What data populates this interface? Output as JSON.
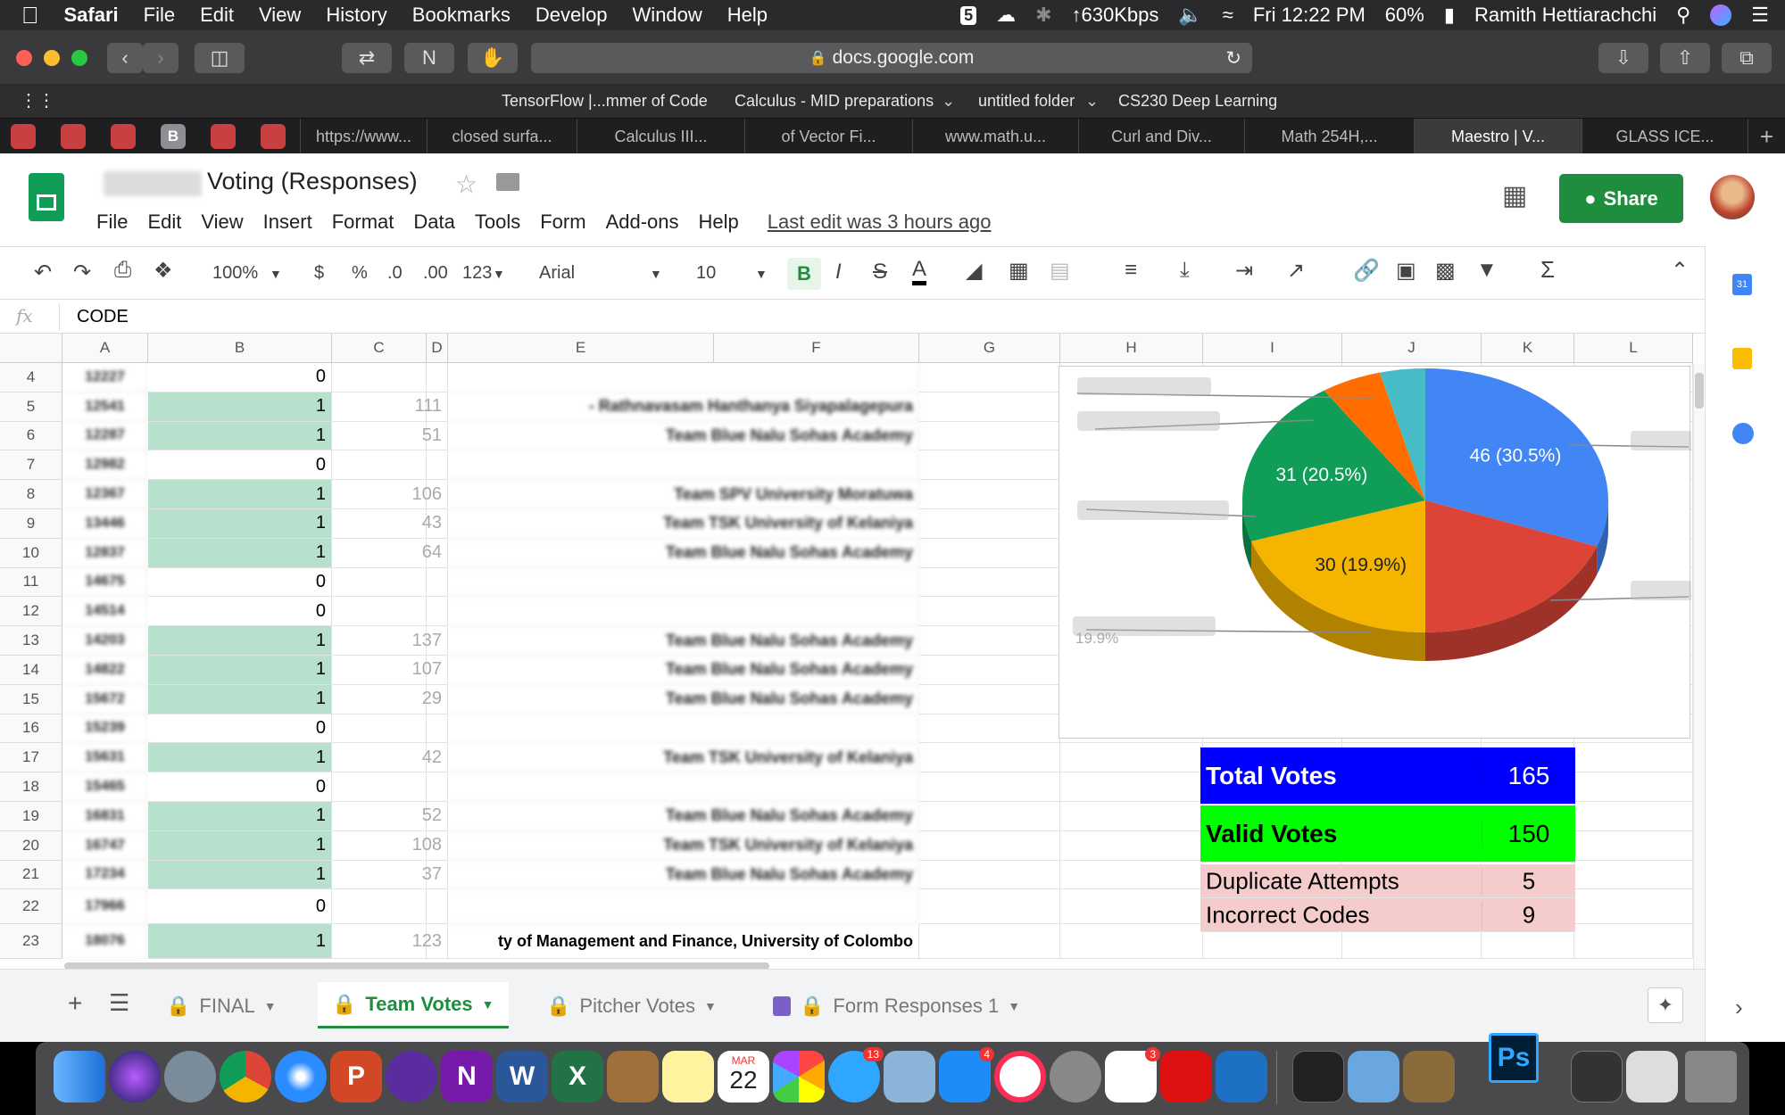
{
  "menubar": {
    "app": "Safari",
    "items": [
      "File",
      "Edit",
      "View",
      "History",
      "Bookmarks",
      "Develop",
      "Window",
      "Help"
    ],
    "network": "↑630Kbps",
    "clock": "Fri 12:22 PM",
    "battery": "60%",
    "user": "Ramith Hettiarachchi"
  },
  "browser": {
    "url": "docs.google.com",
    "favorites": [
      "TensorFlow |...mmer of Code",
      "Calculus - MID preparations",
      "untitled folder",
      "CS230 Deep Learning"
    ],
    "pinned_badge": "B",
    "tabs": [
      "https://www...",
      "closed surfa...",
      "Calculus III...",
      "of Vector Fi...",
      "www.math.u...",
      "Curl and Div...",
      "Math 254H,...",
      "Maestro | V...",
      "GLASS ICE..."
    ],
    "active_tab_index": 7,
    "new_tab": "+"
  },
  "doc": {
    "title": "Voting (Responses)",
    "menus": [
      "File",
      "Edit",
      "View",
      "Insert",
      "Format",
      "Data",
      "Tools",
      "Form",
      "Add-ons",
      "Help"
    ],
    "last_edit": "Last edit was 3 hours ago",
    "share_label": "Share"
  },
  "toolbar": {
    "zoom": "100%",
    "currency": "$",
    "percent": "%",
    "dec_less": ".0",
    "dec_more": ".00",
    "format_more": "123",
    "font": "Arial",
    "font_size": "10",
    "bold": "B",
    "italic": "I",
    "strike": "S",
    "text_color": "A"
  },
  "formula_bar": {
    "fx": "fx",
    "value": "CODE"
  },
  "columns": [
    "A",
    "B",
    "C",
    "D",
    "E",
    "F",
    "G",
    "H",
    "I",
    "J",
    "K",
    "L"
  ],
  "rows": [
    {
      "n": "4",
      "a": "12227",
      "b": "0",
      "d": "",
      "f": ""
    },
    {
      "n": "5",
      "a": "12541",
      "b": "1",
      "d": "111",
      "f": "- Rathnavasam Hanthanya Siyapalagepura"
    },
    {
      "n": "6",
      "a": "12287",
      "b": "1",
      "d": "51",
      "f": "Team Blue Nalu Sohas Academy"
    },
    {
      "n": "7",
      "a": "12982",
      "b": "0",
      "d": "",
      "f": ""
    },
    {
      "n": "8",
      "a": "12367",
      "b": "1",
      "d": "106",
      "f": "Team SPV University Moratuwa"
    },
    {
      "n": "9",
      "a": "13446",
      "b": "1",
      "d": "43",
      "f": "Team TSK University of Kelaniya"
    },
    {
      "n": "10",
      "a": "12837",
      "b": "1",
      "d": "64",
      "f": "Team Blue Nalu Sohas Academy"
    },
    {
      "n": "11",
      "a": "14675",
      "b": "0",
      "d": "",
      "f": ""
    },
    {
      "n": "12",
      "a": "14514",
      "b": "0",
      "d": "",
      "f": ""
    },
    {
      "n": "13",
      "a": "14203",
      "b": "1",
      "d": "137",
      "f": "Team Blue Nalu Sohas Academy"
    },
    {
      "n": "14",
      "a": "14822",
      "b": "1",
      "d": "107",
      "f": "Team Blue Nalu Sohas Academy"
    },
    {
      "n": "15",
      "a": "15672",
      "b": "1",
      "d": "29",
      "f": "Team Blue Nalu Sohas Academy"
    },
    {
      "n": "16",
      "a": "15239",
      "b": "0",
      "d": "",
      "f": ""
    },
    {
      "n": "17",
      "a": "15631",
      "b": "1",
      "d": "42",
      "f": "Team TSK University of Kelaniya"
    },
    {
      "n": "18",
      "a": "15465",
      "b": "0",
      "d": "",
      "f": ""
    },
    {
      "n": "19",
      "a": "16831",
      "b": "1",
      "d": "52",
      "f": "Team Blue Nalu Sohas Academy"
    },
    {
      "n": "20",
      "a": "16747",
      "b": "1",
      "d": "108",
      "f": "Team TSK University of Kelaniya"
    },
    {
      "n": "21",
      "a": "17234",
      "b": "1",
      "d": "37",
      "f": "Team Blue Nalu Sohas Academy"
    },
    {
      "n": "22",
      "a": "17966",
      "b": "0",
      "d": "",
      "f": ""
    },
    {
      "n": "23",
      "a": "18076",
      "b": "1",
      "d": "123",
      "f": "ty of Management and Finance, University of Colombo"
    }
  ],
  "summary": [
    {
      "label": "Total Votes",
      "value": "165",
      "bg": "#0000ff",
      "fg": "#ffffff",
      "bold": true
    },
    {
      "label": "Valid Votes",
      "value": "150",
      "bg": "#00ff00",
      "fg": "#000000",
      "bold": true
    },
    {
      "label": "Duplicate Attempts",
      "value": "5",
      "bg": "#f4cccc",
      "fg": "#000000",
      "bold": false
    },
    {
      "label": "Incorrect Codes",
      "value": "9",
      "bg": "#f4cccc",
      "fg": "#000000",
      "bold": false
    }
  ],
  "chart_data": {
    "type": "pie",
    "title": "",
    "slices": [
      {
        "label": "46 (30.5%)",
        "value": 46,
        "color": "#4285f4"
      },
      {
        "label": "",
        "value": 29,
        "color": "#db4437"
      },
      {
        "label": "30 (19.9%)",
        "value": 30,
        "color": "#f4b400"
      },
      {
        "label": "31 (20.5%)",
        "value": 31,
        "color": "#0f9d58"
      },
      {
        "label": "",
        "value": 8,
        "color": "#ff6d00"
      },
      {
        "label": "",
        "value": 6,
        "color": "#46bdc6"
      }
    ],
    "hidden_label": "19.9%"
  },
  "sheet_tabs": [
    {
      "label": "FINAL",
      "active": false
    },
    {
      "label": "Team Votes",
      "active": true
    },
    {
      "label": "Pitcher Votes",
      "active": false
    },
    {
      "label": "Form Responses 1",
      "active": false
    }
  ],
  "dock": {
    "calendar_month": "MAR",
    "calendar_day": "22",
    "messages_badge": "13",
    "appstore_badge": "4",
    "reminders_badge": "3",
    "ps_label": "Ps"
  },
  "sidepanel": {
    "calendar_day": "31"
  }
}
